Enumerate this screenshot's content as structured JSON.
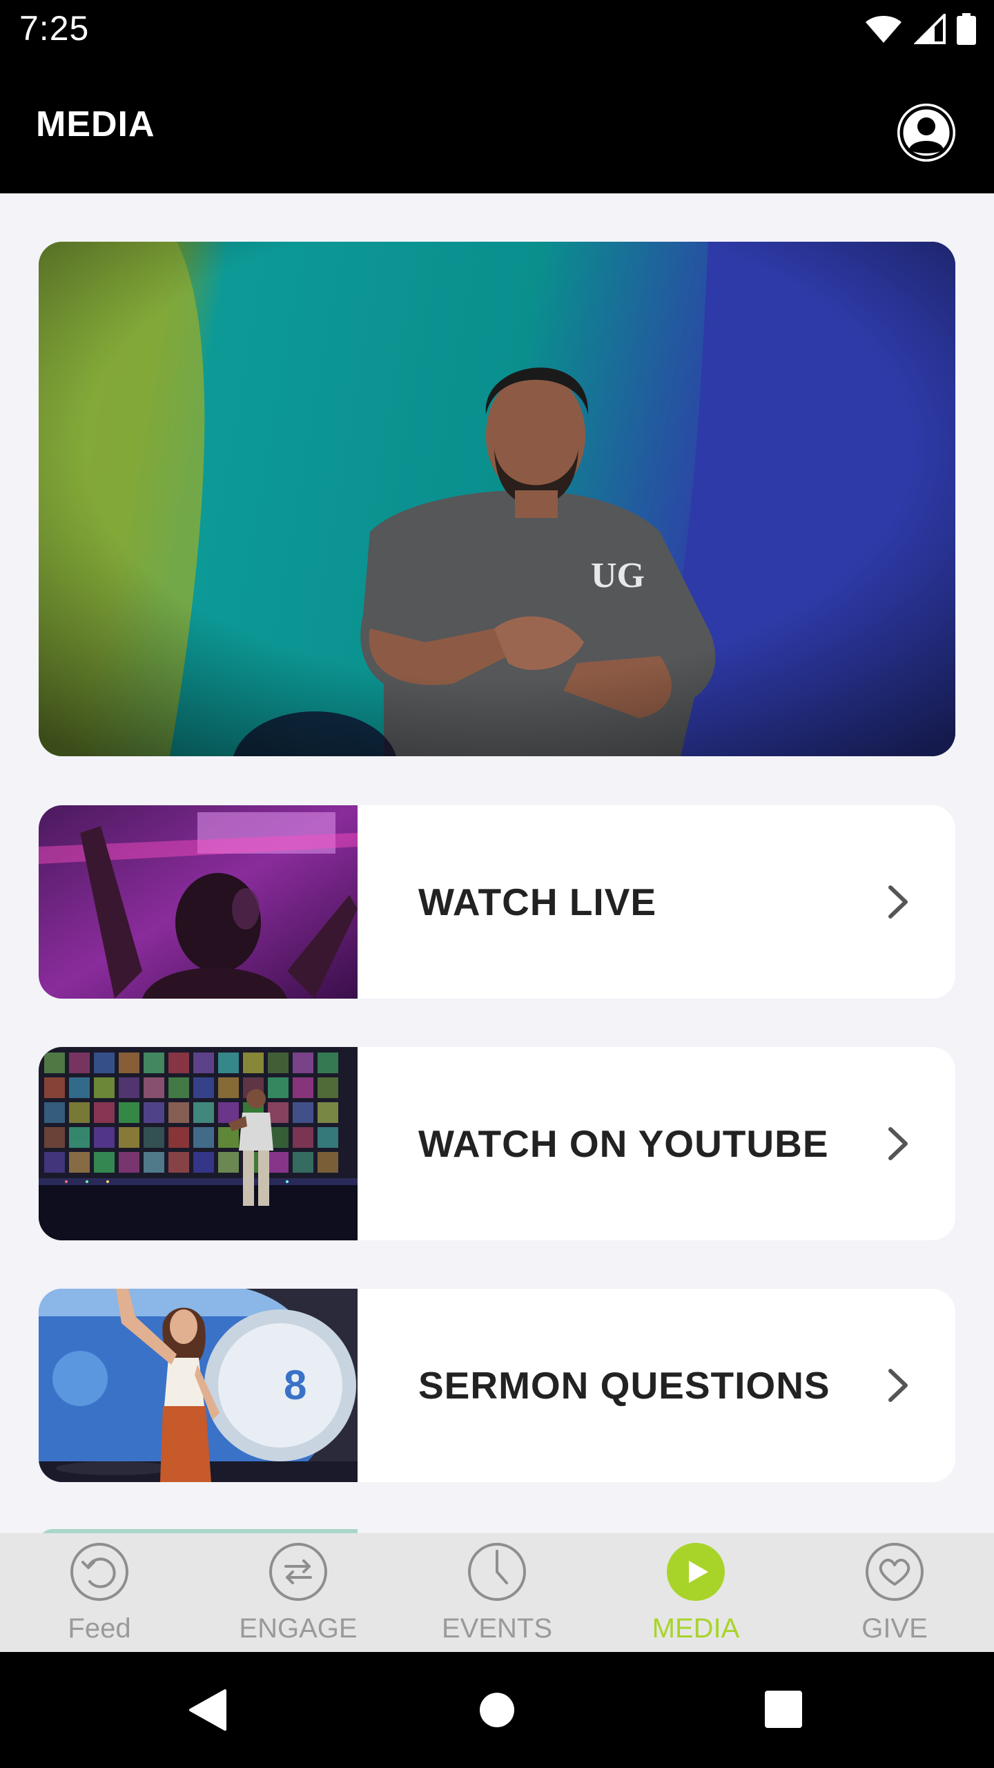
{
  "status_bar": {
    "time": "7:25",
    "icons": [
      "wifi-icon",
      "cellular-signal-icon",
      "battery-icon"
    ]
  },
  "app_bar": {
    "title": "MEDIA",
    "profile_icon": "user-avatar-icon"
  },
  "hero": {
    "image": "speaker-on-stage-photo"
  },
  "cards": [
    {
      "label": "WATCH LIVE",
      "image": "worship-crowd-photo",
      "icon": "chevron-right-icon"
    },
    {
      "label": "WATCH ON YOUTUBE",
      "image": "speaker-colorful-stage-photo",
      "icon": "chevron-right-icon"
    },
    {
      "label": "SERMON QUESTIONS",
      "image": "woman-speaker-photo",
      "icon": "chevron-right-icon"
    }
  ],
  "bottom_nav": {
    "items": [
      {
        "label": "Feed",
        "icon": "history-icon",
        "active": false
      },
      {
        "label": "ENGAGE",
        "icon": "swap-arrows-icon",
        "active": false
      },
      {
        "label": "EVENTS",
        "icon": "clock-icon",
        "active": false
      },
      {
        "label": "MEDIA",
        "icon": "play-icon",
        "active": true
      },
      {
        "label": "GIVE",
        "icon": "heart-icon",
        "active": false
      }
    ]
  },
  "colors": {
    "accent": "#a8d42a",
    "app_bar": "#000000",
    "background": "#f3f3f8",
    "nav_background": "#e6e6e6",
    "nav_inactive": "#9a9a9a"
  }
}
